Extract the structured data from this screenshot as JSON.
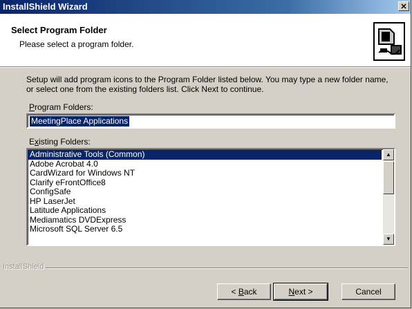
{
  "window": {
    "title": "InstallShield Wizard",
    "close_glyph": "✕"
  },
  "header": {
    "title": "Select Program Folder",
    "subtitle": "Please select a program folder.",
    "icon": "computer-setup-icon"
  },
  "description": "Setup will add program icons to the Program Folder listed below.  You may type a new folder name, or select one from the existing folders list.  Click Next to continue.",
  "program_folders": {
    "label_hotkey": "P",
    "label_rest": "rogram Folders:",
    "value": "MeetingPlace Applications"
  },
  "existing_folders": {
    "label_pre": "E",
    "label_hotkey": "x",
    "label_rest": "isting Folders:",
    "items": [
      "Administrative Tools (Common)",
      "Adobe Acrobat 4.0",
      "CardWizard for Windows NT",
      "Clarify eFrontOffice8",
      "ConfigSafe",
      "HP LaserJet",
      "Latitude Applications",
      "Mediamatics DVDExpress",
      "Microsoft SQL Server 6.5"
    ],
    "selected_index": 0
  },
  "footer": {
    "brand": "InstallShield"
  },
  "buttons": {
    "back_pre": "< ",
    "back_hotkey": "B",
    "back_rest": "ack",
    "next_hotkey": "N",
    "next_rest": "ext >",
    "cancel": "Cancel"
  },
  "colors": {
    "title_bar": "#0a246a",
    "selection": "#0a246a",
    "face": "#d4d0c8"
  }
}
